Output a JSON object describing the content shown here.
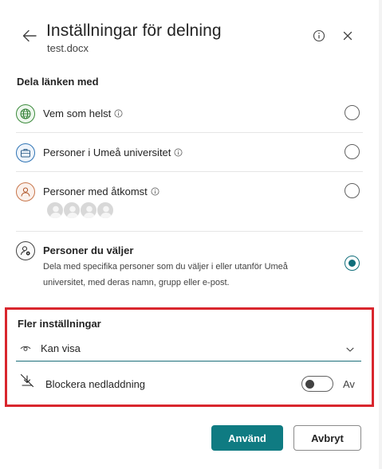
{
  "header": {
    "title": "Inställningar för delning",
    "subtitle": "test.docx",
    "back_icon": "arrow-left-icon",
    "info_icon": "info-icon",
    "close_icon": "close-icon"
  },
  "share_section": {
    "title": "Dela länken med",
    "options": [
      {
        "label": "Vem som helst",
        "icon": "globe-icon",
        "has_info": true,
        "selected": false
      },
      {
        "label": "Personer i Umeå universitet",
        "icon": "briefcase-icon",
        "has_info": true,
        "selected": false
      },
      {
        "label": "Personer med åtkomst",
        "icon": "person-icon",
        "has_info": true,
        "selected": false
      },
      {
        "label": "Personer du väljer",
        "icon": "person-settings-icon",
        "has_info": false,
        "selected": true,
        "description": "Dela med specifika personer som du väljer i eller utanför Umeå universitet, med deras namn, grupp eller e-post."
      }
    ]
  },
  "more_settings": {
    "title": "Fler inställningar",
    "permission": {
      "value": "Kan visa",
      "icon": "eye-icon"
    },
    "block_download": {
      "label": "Blockera nedladdning",
      "icon": "download-blocked-icon",
      "state_label": "Av",
      "on": false
    }
  },
  "footer": {
    "apply_label": "Använd",
    "cancel_label": "Avbryt"
  },
  "colors": {
    "accent": "#0f7b82",
    "highlight_border": "#d9262d"
  }
}
